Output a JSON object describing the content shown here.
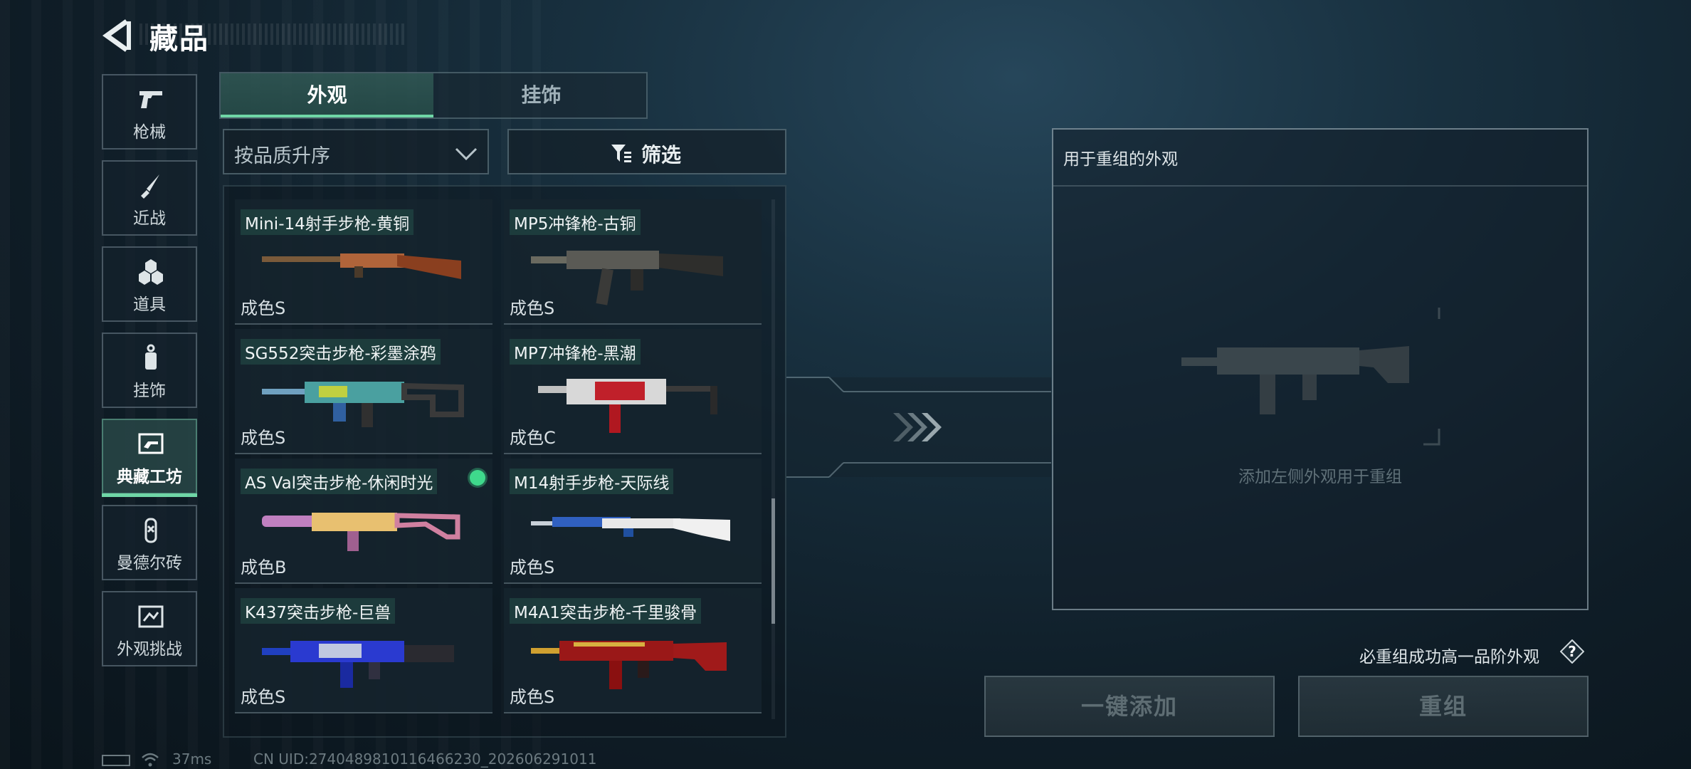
{
  "header": {
    "title": "藏品"
  },
  "sidebar": {
    "items": [
      {
        "label": "枪械",
        "icon": "pistol-icon"
      },
      {
        "label": "近战",
        "icon": "knife-icon"
      },
      {
        "label": "道具",
        "icon": "grenade-icon"
      },
      {
        "label": "挂饰",
        "icon": "charm-icon"
      },
      {
        "label": "典藏工坊",
        "icon": "workshop-icon",
        "active": true
      },
      {
        "label": "曼德尔砖",
        "icon": "brick-icon"
      },
      {
        "label": "外观挑战",
        "icon": "challenge-icon"
      }
    ]
  },
  "tabs": [
    {
      "label": "外观",
      "active": true
    },
    {
      "label": "挂饰",
      "active": false
    }
  ],
  "sort": {
    "label": "按品质升序"
  },
  "filter": {
    "label": "筛选"
  },
  "items": [
    {
      "name": "Mini-14射手步枪-黄铜",
      "grade": "成色S"
    },
    {
      "name": "MP5冲锋枪-古铜",
      "grade": "成色S"
    },
    {
      "name": "SG552突击步枪-彩墨涂鸦",
      "grade": "成色S"
    },
    {
      "name": "MP7冲锋枪-黑潮",
      "grade": "成色C"
    },
    {
      "name": "AS Val突击步枪-休闲时光",
      "grade": "成色B",
      "selected": true
    },
    {
      "name": "M14射手步枪-天际线",
      "grade": "成色S"
    },
    {
      "name": "K437突击步枪-巨兽",
      "grade": "成色S"
    },
    {
      "name": "M4A1突击步枪-千里骏骨",
      "grade": "成色S"
    }
  ],
  "panel": {
    "title": "用于重组的外观",
    "hint": "添加左侧外观用于重组"
  },
  "guarantee": "必重组成功高一品阶外观",
  "buttons": {
    "add_all": "一键添加",
    "regroup": "重组"
  },
  "status": {
    "ping": "37ms",
    "uid": "CN UID:2740489810116466230_202606291011"
  },
  "colors": {
    "accent": "#6fd6a6",
    "selected_dot": "#3fd98c"
  }
}
